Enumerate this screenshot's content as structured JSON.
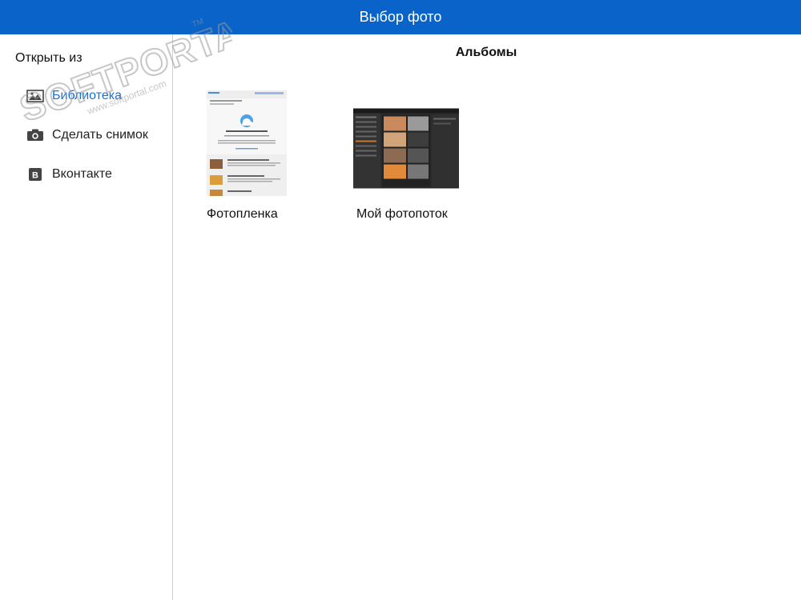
{
  "header": {
    "title": "Выбор фото"
  },
  "sidebar": {
    "heading": "Открыть из",
    "items": [
      {
        "label": "Библиотека",
        "icon": "photo-library-icon",
        "active": true
      },
      {
        "label": "Сделать снимок",
        "icon": "camera-icon",
        "active": false
      },
      {
        "label": "Вконтакте",
        "icon": "vk-icon",
        "active": false
      }
    ]
  },
  "main": {
    "title": "Альбомы",
    "albums": [
      {
        "label": "Фотопленка"
      },
      {
        "label": "Мой фотопоток"
      }
    ]
  },
  "watermark": {
    "brand": "SOFTPORTAL",
    "url": "www.softportal.com",
    "tm": "TM"
  },
  "colors": {
    "accent": "#0a63c9",
    "active_item": "#1a6fd4"
  }
}
